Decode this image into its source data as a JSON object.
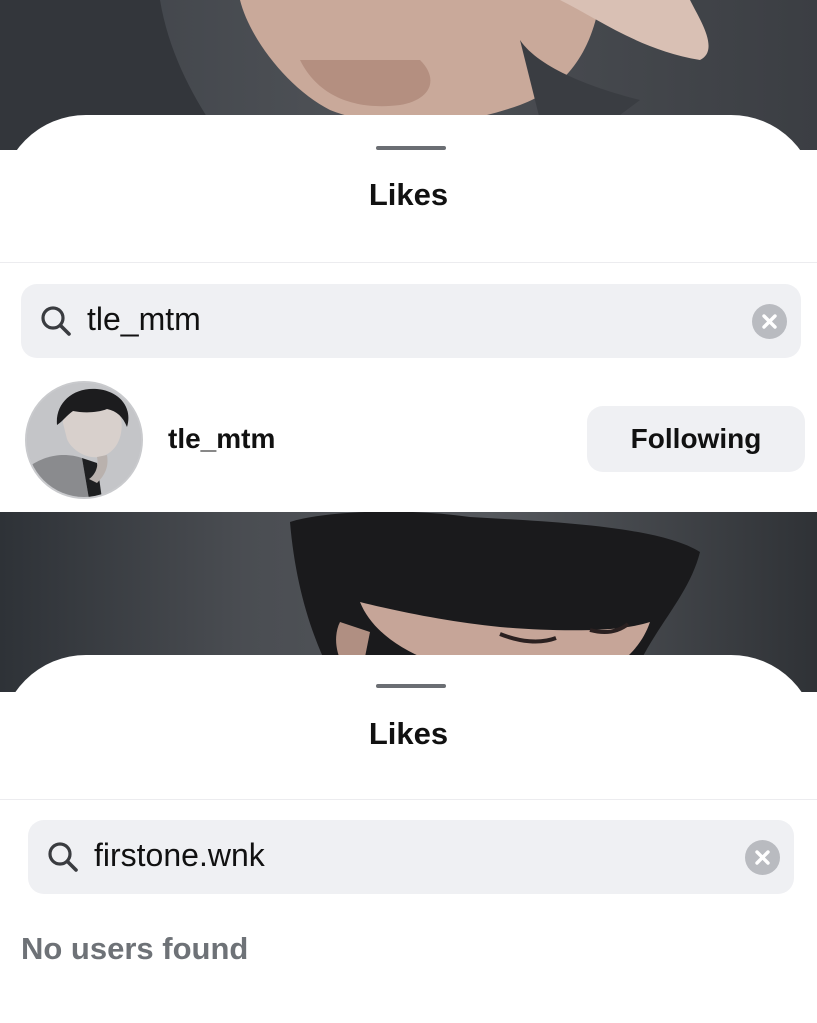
{
  "top_panel": {
    "title": "Likes",
    "search": {
      "value": "tle_mtm",
      "icon": "search-icon",
      "clear_icon": "clear-icon"
    },
    "results": [
      {
        "username": "tle_mtm",
        "button_label": "Following"
      }
    ]
  },
  "bottom_panel": {
    "title": "Likes",
    "search": {
      "value": "firstone.wnk",
      "icon": "search-icon",
      "clear_icon": "clear-icon"
    },
    "empty_message": "No users found"
  },
  "colors": {
    "sheet": "#ffffff",
    "search_bg": "#eff0f3",
    "button_bg": "#eff0f3",
    "empty_text": "#6e7277",
    "clear_icon": "#b9bbc0"
  }
}
